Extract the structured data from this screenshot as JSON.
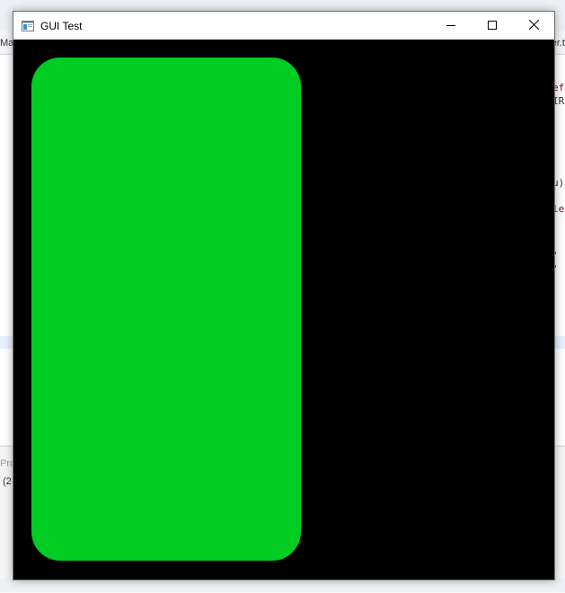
{
  "window": {
    "title": "GUI Test"
  },
  "canvas": {
    "background_color": "#000000",
    "shape_color": "#00cc22"
  },
  "background_ide": {
    "left_tab_label": "Mai",
    "right_tab_label": "er.t",
    "code_fragments": [
      "ef",
      "IR",
      "u)",
      "le",
      ", ",
      ","
    ],
    "panel_tab_label": "Pro",
    "panel_row_label": "(2"
  },
  "icons": {
    "app": "window-app-icon",
    "minimize": "minimize-icon",
    "maximize": "maximize-icon",
    "close": "close-icon"
  }
}
